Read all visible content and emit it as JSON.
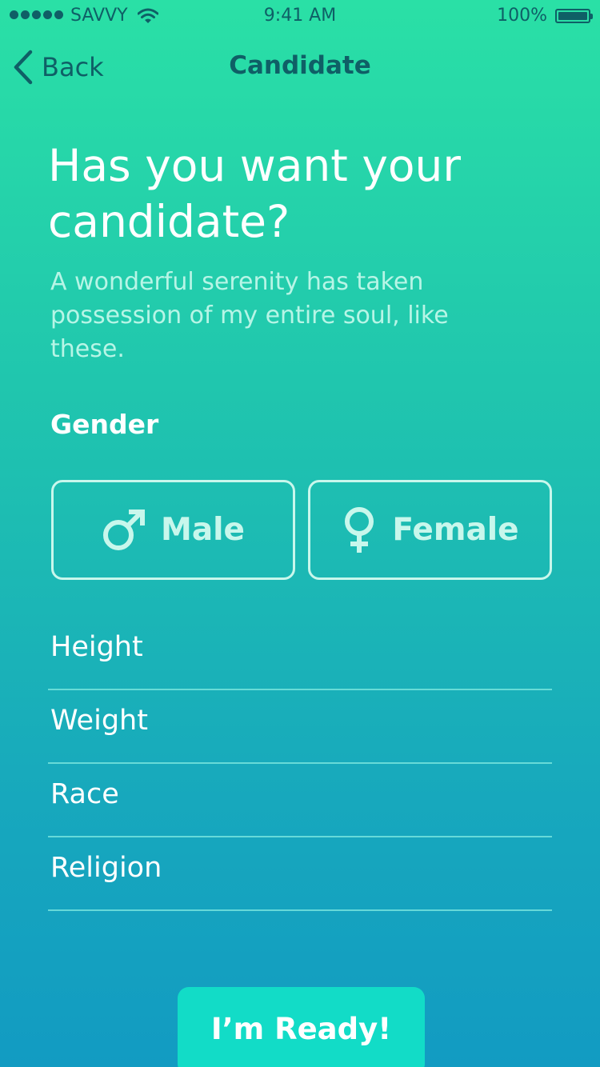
{
  "status_bar": {
    "carrier": "SAVVY",
    "time": "9:41 AM",
    "battery": "100%"
  },
  "nav": {
    "back_label": "Back",
    "title": "Candidate"
  },
  "content": {
    "headline": "Has you want your candidate?",
    "subtext": "A wonderful serenity has taken possession of my entire soul, like these.",
    "gender_label": "Gender",
    "gender_options": [
      {
        "label": "Male",
        "icon": "male-symbol-icon"
      },
      {
        "label": "Female",
        "icon": "female-symbol-icon"
      }
    ],
    "fields": [
      {
        "label": "Height"
      },
      {
        "label": "Weight"
      },
      {
        "label": "Race"
      },
      {
        "label": "Religion"
      }
    ],
    "cta_label": "I’m Ready!"
  },
  "colors": {
    "gradient_top": "#2ae0a6",
    "gradient_bottom": "#129bc2",
    "nav_text": "#0f5f66",
    "outline": "#c8f7ec",
    "cta": "#12dcc7"
  }
}
